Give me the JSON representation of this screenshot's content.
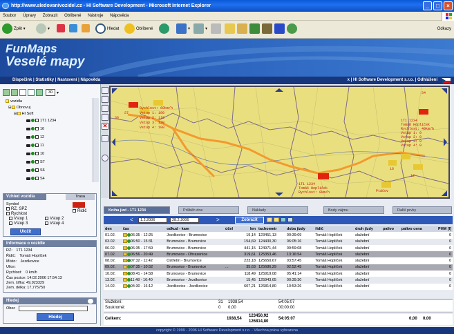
{
  "window": {
    "title": "http://www.sledovanivozidel.cz - HI Software Development - Microsoft Internet Explorer"
  },
  "menu": [
    "Soubor",
    "Úpravy",
    "Zobrazit",
    "Oblíbené",
    "Nástroje",
    "Nápověda"
  ],
  "toolbar": {
    "back": "Zpět",
    "search": "Hledat",
    "favorites": "Oblíbené",
    "links": "Odkazy"
  },
  "banner": {
    "line1": "FunMaps",
    "line2": "Veselé mapy"
  },
  "nav": {
    "items": [
      "Dispečink",
      "Statistiky",
      "Nastavení",
      "Nápověda"
    ],
    "company": "HI Software Development s.r.o.",
    "logout": "Odhlášení",
    "close": "x"
  },
  "left": {
    "zoom_value": "30",
    "tree": {
      "root": "vozidla",
      "group": "Obnovuj",
      "subgroup": "HI Soft",
      "vehicles": [
        "1T1 1234",
        "16",
        "12",
        "11",
        "10",
        "S7",
        "S6",
        "S4"
      ]
    },
    "legend_box": {
      "title": "Vzhled vozidla",
      "tab2": "Trasa",
      "symbol": "Symbol",
      "rz": "RZ, SPZ",
      "ridic": "Řidič",
      "rychlost": "Rychlost",
      "vstup1": "Vstup 1",
      "vstup2": "Vstup 2",
      "vstup3": "Vstup 3",
      "vstup4": "Vstup 4",
      "save": "Uložit"
    },
    "info_box": {
      "title": "Informace o vozidle",
      "rz_label": "RZ:",
      "rz": "1T1 1234",
      "ridic_label": "Řidič:",
      "ridic": "Tomáš Hoplíček",
      "misto_label": "Místo:",
      "misto": "Jezdkovice",
      "ulice_label": "Ulice:",
      "ulice": "",
      "rychlost_label": "Rychlost:",
      "rychlost": "0 km/h",
      "cas_label": "Čas pozice:",
      "cas": "14.02.2006 17:54:13",
      "sirka_label": "Zem. šířka:",
      "sirka": "49,923329",
      "delka_label": "Zem. délka:",
      "delka": "17,775750"
    },
    "search_box": {
      "title": "Hledej",
      "obec": "Obec",
      "button": "Hledej"
    }
  },
  "map": {
    "labels": [
      {
        "text": "Rychlost: 60km/h"
      },
      {
        "text": "Vstup 1: 100"
      },
      {
        "text": "Vstup 2: 110"
      },
      {
        "text": "Vstup 3: 120"
      },
      {
        "text": "Vstup 4: 100"
      },
      {
        "text": "1T1 1234"
      },
      {
        "text": "Tomáš Hoplíček"
      },
      {
        "text": "Rychlost: 40km/h"
      },
      {
        "text": "Vstup 1: 0"
      },
      {
        "text": "Vstup 2: 0"
      },
      {
        "text": "Vstup 3: 0"
      },
      {
        "text": "Vstup 4: 0"
      },
      {
        "text": "1T1 1234"
      },
      {
        "text": "Tomáš Hoplíček"
      },
      {
        "text": "Rychlost: 0km/h"
      },
      {
        "text": "S7"
      },
      {
        "text": "S6"
      },
      {
        "text": "S4"
      },
      {
        "text": "16"
      },
      {
        "text": "12"
      },
      {
        "text": "Ptáčov"
      }
    ]
  },
  "tabs": {
    "t1": "Kniha jízd - 1T1 1234",
    "t2": "Průběh dne",
    "t3": "Náklady",
    "t4": "Body zájmu",
    "t5": "Další prvky"
  },
  "datebar": {
    "from": "1.2.2006",
    "to": "28.2.2006",
    "button": "Zobrazit"
  },
  "table": {
    "headers": [
      "den",
      "čas",
      "odkud - kam",
      "účel",
      "km",
      "tachometr",
      "doba jízdy",
      "řidič",
      "druh jízdy",
      "palivo",
      "palivo cena",
      "PHM [l]"
    ],
    "rows": [
      [
        "01.02.",
        "06:35 - 12:25",
        "Jezdkovice - Brumovice",
        "",
        "19,14",
        "123451,13",
        "00:39:09",
        "Tomáš Hoplíček",
        "služební",
        "",
        "",
        "0"
      ],
      [
        "03.02.",
        "06:50 - 15:31",
        "Brumovice - Brumovice",
        "",
        "154,69",
        "124430,30",
        "06:05:16",
        "Tomáš Hoplíček",
        "služební",
        "",
        "",
        "0"
      ],
      [
        "06.02.",
        "06:35 - 17:59",
        "Brumovice - Brumovice",
        "",
        "441,15",
        "124971,44",
        "09:59:08",
        "Tomáš Hoplíček",
        "služební",
        "",
        "",
        "0"
      ],
      [
        "07.02.",
        "06:56 - 20:49",
        "Brumovice - Ohrazenice",
        "",
        "319,61",
        "125353,46",
        "13:16:54",
        "Tomáš Hoplíček",
        "služební",
        "",
        "",
        "0"
      ],
      [
        "08.02.",
        "07:32 - 11:42",
        "Ostřetín - Brumovice",
        "",
        "223,18",
        "125650,67",
        "03:57:45",
        "Tomáš Hoplíček",
        "služební",
        "",
        "",
        "0"
      ],
      [
        "09.02.",
        "07:35 - 10:52",
        "Brumovice - Brumovice",
        "...",
        "35,63",
        "125686,29",
        "02:52:45",
        "Tomáš Hoplíček",
        "služební",
        "",
        "",
        "0"
      ],
      [
        "10.02.",
        "08:41 - 14:58",
        "Brumovice - Brumovice",
        "",
        "118,49",
        "125919,08",
        "05:41:14",
        "Tomáš Hoplíček",
        "služební",
        "",
        "",
        "0"
      ],
      [
        "13.02.",
        "11:48 - 16:40",
        "Brumovice - Jezdkovice",
        "",
        "15,45",
        "125943,65",
        "00:39:30",
        "Tomáš Hoplíček",
        "služební",
        "",
        "",
        "0"
      ],
      [
        "14.02.",
        "04:30 - 16:12",
        "Jezdkovice - Jezdkovice",
        "",
        "607,21",
        "126814,80",
        "10:53:26",
        "Tomáš Hoplíček",
        "služební",
        "",
        "",
        "0"
      ]
    ],
    "summary": [
      {
        "label": "Služební:",
        "count": "31",
        "km": "1938,54",
        "time": "54:05:07"
      },
      {
        "label": "Soukromé:",
        "count": "0",
        "km": "0,00",
        "time": "00:00:00"
      }
    ],
    "total": {
      "label": "Celkem:",
      "km": "1938,54",
      "tacho1": "123450,92",
      "tacho2": "126814,80",
      "time": "54:05:07",
      "fuel": "0,00",
      "fuel2": "0,00"
    }
  },
  "footer": "copyright © 1999 - 2006 HI Software Development s.r.o. - Všechna práva vyhrazena"
}
